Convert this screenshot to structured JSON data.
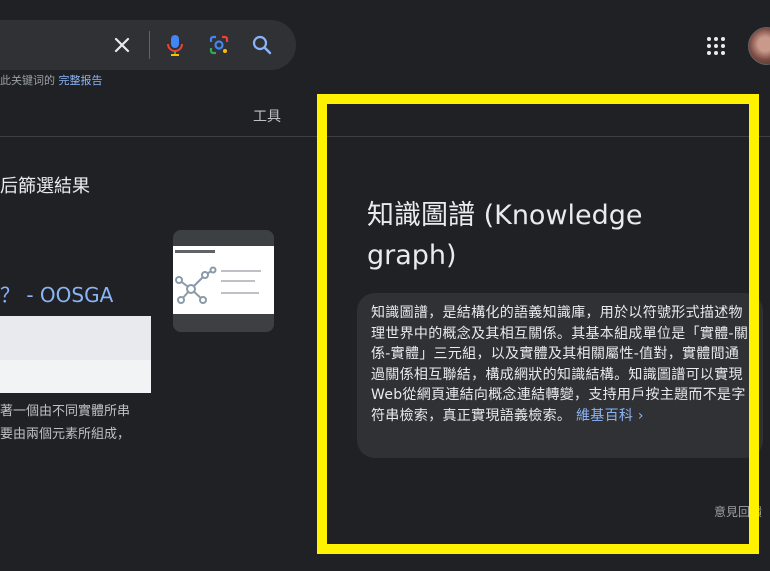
{
  "search": {
    "meta_prefix": "此关键词的",
    "meta_link": "完整报告"
  },
  "toolbar": {
    "tools_label": "工具"
  },
  "results": {
    "filter_text": "后篩選結果",
    "title": "？ - OOSGA",
    "snippet_lines": [
      "著一個由不同實體所串",
      "要由兩個元素所組成，"
    ]
  },
  "knowledge_panel": {
    "title": "知識圖譜 (Knowledge graph)",
    "description": "知識圖譜，是結構化的語義知識庫，用於以符號形式描述物理世界中的概念及其相互關係。其基本組成單位是「實體-關係-實體」三元組，以及實體及其相關屬性-值對，實體間通過關係相互聯結，構成網狀的知識結構。知識圖譜可以實現Web從網頁連結向概念連結轉變，支持用戶按主題而不是字符串檢索，真正實現語義檢索。",
    "source_label": "維基百科 ›",
    "feedback_label": "意見回饋"
  },
  "colors": {
    "background": "#202124",
    "highlight_frame": "#fff200",
    "link": "#8ab4f8"
  },
  "icons": [
    "clear-icon",
    "microphone-icon",
    "camera-lens-icon",
    "search-icon",
    "apps-grid-icon",
    "more-vert-icon"
  ]
}
